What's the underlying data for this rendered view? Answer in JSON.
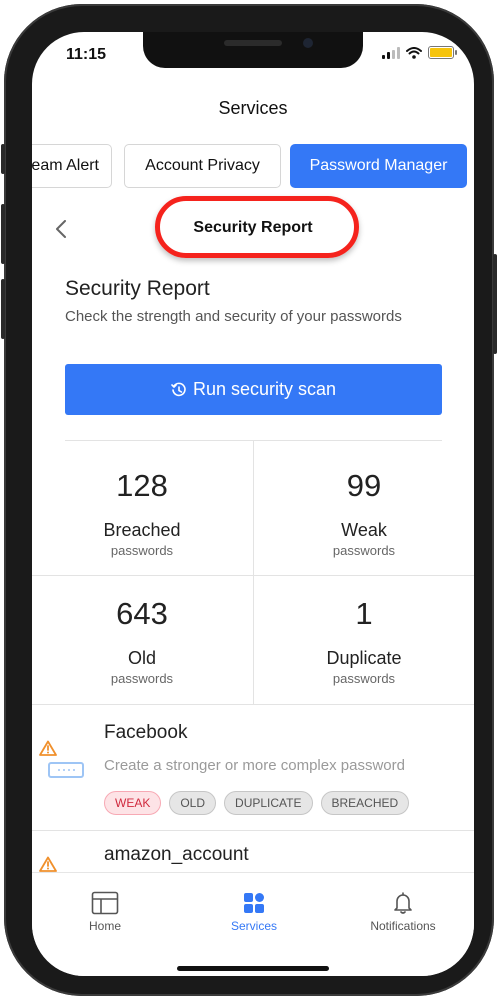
{
  "status_bar": {
    "time": "11:15"
  },
  "header": {
    "title": "Services"
  },
  "tabs": [
    {
      "label": "Dream Alert",
      "active": false
    },
    {
      "label": "Account Privacy",
      "active": false
    },
    {
      "label": "Password Manager",
      "active": true
    }
  ],
  "subheader": {
    "title": "Security Report"
  },
  "report": {
    "title": "Security Report",
    "subtitle": "Check the strength and security of your passwords",
    "scan_button": "Run security scan"
  },
  "stats": [
    {
      "value": "128",
      "label": "Breached",
      "unit": "passwords"
    },
    {
      "value": "99",
      "label": "Weak",
      "unit": "passwords"
    },
    {
      "value": "643",
      "label": "Old",
      "unit": "passwords"
    },
    {
      "value": "1",
      "label": "Duplicate",
      "unit": "passwords"
    }
  ],
  "issues": [
    {
      "name": "Facebook",
      "description": "Create a stronger or more complex password",
      "badges": [
        "WEAK",
        "OLD",
        "DUPLICATE",
        "BREACHED"
      ]
    },
    {
      "name": "amazon_account"
    }
  ],
  "tabbar": [
    {
      "label": "Home",
      "icon": "home-icon",
      "active": false
    },
    {
      "label": "Services",
      "icon": "services-icon",
      "active": true
    },
    {
      "label": "Notifications",
      "icon": "bell-icon",
      "active": false
    }
  ],
  "colors": {
    "accent": "#3478f6",
    "highlight": "#f5231d",
    "warning": "#f0902c"
  }
}
